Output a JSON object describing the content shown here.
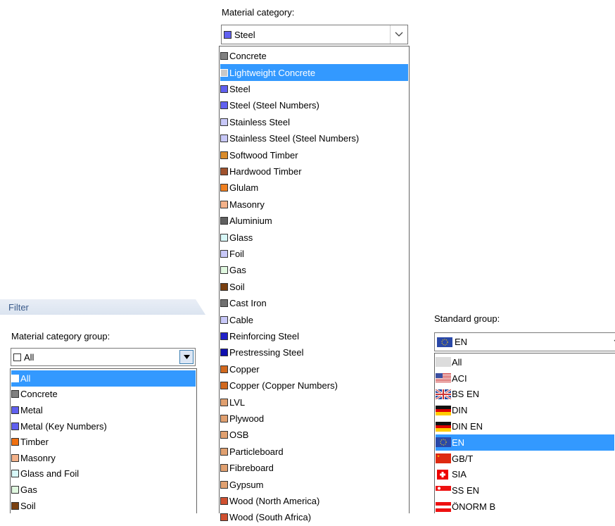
{
  "material_category": {
    "label": "Material category:",
    "selected": {
      "label": "Steel",
      "color": "#6060f0"
    },
    "items": [
      {
        "label": "Concrete",
        "color": "#808080"
      },
      {
        "label": "Lightweight Concrete",
        "color": "#c8c8c8",
        "selected": true
      },
      {
        "label": "Steel",
        "color": "#6060f0"
      },
      {
        "label": "Steel (Steel Numbers)",
        "color": "#6060f0"
      },
      {
        "label": "Stainless Steel",
        "color": "#c8c8f8"
      },
      {
        "label": "Stainless Steel (Steel Numbers)",
        "color": "#c8c8f8"
      },
      {
        "label": "Softwood Timber",
        "color": "#d98b2b"
      },
      {
        "label": "Hardwood Timber",
        "color": "#a0522d"
      },
      {
        "label": "Glulam",
        "color": "#f08020"
      },
      {
        "label": "Masonry",
        "color": "#f4b28a"
      },
      {
        "label": "Aluminium",
        "color": "#606060"
      },
      {
        "label": "Glass",
        "color": "#d8f8f8"
      },
      {
        "label": "Foil",
        "color": "#c8c8f8"
      },
      {
        "label": "Gas",
        "color": "#e0f8e0"
      },
      {
        "label": "Soil",
        "color": "#7a4010"
      },
      {
        "label": "Cast Iron",
        "color": "#707070"
      },
      {
        "label": "Cable",
        "color": "#c8c8f8"
      },
      {
        "label": "Reinforcing Steel",
        "color": "#2020c8"
      },
      {
        "label": "Prestressing Steel",
        "color": "#1010b0"
      },
      {
        "label": "Copper",
        "color": "#d2691e"
      },
      {
        "label": "Copper (Copper Numbers)",
        "color": "#d2691e"
      },
      {
        "label": "LVL",
        "color": "#e0a070"
      },
      {
        "label": "Plywood",
        "color": "#e0a070"
      },
      {
        "label": "OSB",
        "color": "#e0a070"
      },
      {
        "label": "Particleboard",
        "color": "#e0a070"
      },
      {
        "label": "Fibreboard",
        "color": "#e0a070"
      },
      {
        "label": "Gypsum",
        "color": "#e0a070"
      },
      {
        "label": "Wood (North America)",
        "color": "#d05030"
      },
      {
        "label": "Wood (South Africa)",
        "color": "#d05030"
      }
    ]
  },
  "filter": {
    "title": "Filter",
    "group_label": "Material category group:",
    "selected": {
      "label": "All",
      "color": "#ffffff"
    },
    "items": [
      {
        "label": "All",
        "color": "#ffffff",
        "selected": true
      },
      {
        "label": "Concrete",
        "color": "#808080"
      },
      {
        "label": "Metal",
        "color": "#6060f0"
      },
      {
        "label": "Metal (Key Numbers)",
        "color": "#6060f0"
      },
      {
        "label": "Timber",
        "color": "#f07010"
      },
      {
        "label": "Masonry",
        "color": "#f4b28a"
      },
      {
        "label": "Glass and Foil",
        "color": "#d8f8f8"
      },
      {
        "label": "Gas",
        "color": "#e0f8e0"
      },
      {
        "label": "Soil",
        "color": "#7a4010"
      }
    ]
  },
  "standard_group": {
    "label": "Standard group:",
    "selected": {
      "label": "EN",
      "flag": "eu-flag-icon"
    },
    "items": [
      {
        "label": "All",
        "flag": "blank-flag-icon"
      },
      {
        "label": "ACI",
        "flag": "us-flag-icon"
      },
      {
        "label": "BS EN",
        "flag": "uk-flag-icon"
      },
      {
        "label": "DIN",
        "flag": "germany-flag-icon"
      },
      {
        "label": "DIN EN",
        "flag": "germany-flag-icon"
      },
      {
        "label": "EN",
        "flag": "eu-flag-icon",
        "selected": true
      },
      {
        "label": "GB/T",
        "flag": "china-flag-icon"
      },
      {
        "label": "SIA",
        "flag": "swiss-flag-icon"
      },
      {
        "label": "SS EN",
        "flag": "singapore-flag-icon"
      },
      {
        "label": "ÖNORM B",
        "flag": "austria-flag-icon"
      }
    ]
  }
}
